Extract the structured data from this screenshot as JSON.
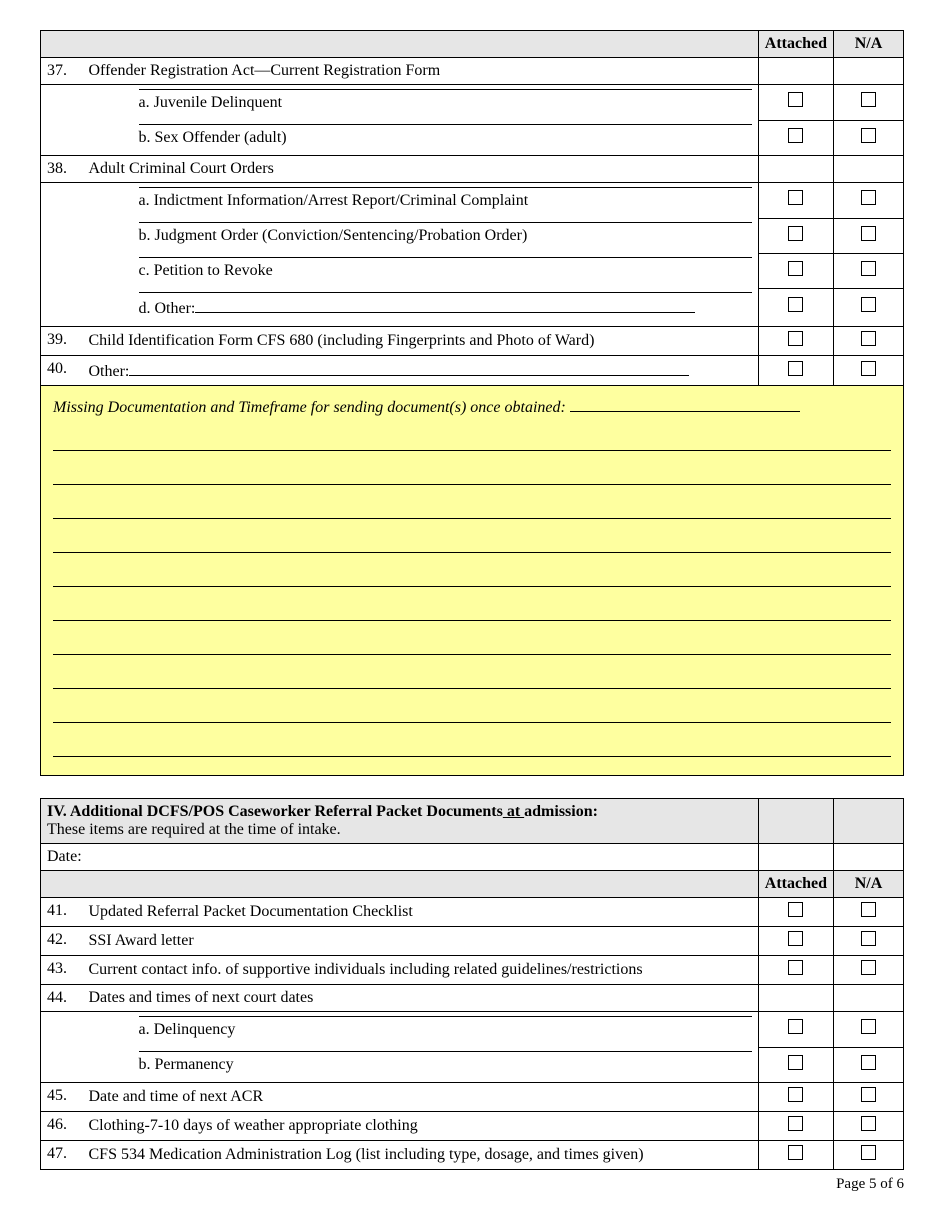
{
  "headers": {
    "attached": "Attached",
    "na": "N/A"
  },
  "rows1": [
    {
      "num": "37.",
      "text": "Offender Registration Act—Current Registration Form",
      "check": false,
      "subs": [
        {
          "text": "a. Juvenile Delinquent"
        },
        {
          "text": "b. Sex Offender (adult)"
        }
      ]
    },
    {
      "num": "38.",
      "text": "Adult Criminal Court Orders",
      "check": false,
      "subs": [
        {
          "text": "a.  Indictment Information/Arrest Report/Criminal Complaint"
        },
        {
          "text": "b. Judgment Order (Conviction/Sentencing/Probation Order)"
        },
        {
          "text": "c. Petition to Revoke"
        },
        {
          "text": "d. Other:",
          "fill": true
        }
      ]
    },
    {
      "num": "39.",
      "text": "Child Identification Form CFS 680  (including Fingerprints and Photo of Ward)",
      "check": true
    },
    {
      "num": "40.",
      "text": "Other:",
      "check": true,
      "fill": true
    }
  ],
  "missing_label": "Missing Documentation and Timeframe for sending document(s) once obtained: ",
  "section4": {
    "title_prefix": "IV. Additional DCFS/POS Caseworker Referral Packet Documents",
    "title_at": " at ",
    "title_suffix": "admission:",
    "subtitle": "These items are required at the time of intake.",
    "date_label": "Date:"
  },
  "rows2": [
    {
      "num": "41.",
      "text": "Updated Referral Packet Documentation Checklist",
      "check": true
    },
    {
      "num": "42.",
      "text": "SSI Award letter",
      "check": true
    },
    {
      "num": "43.",
      "text": "Current contact info. of supportive individuals including related guidelines/restrictions",
      "check": true
    },
    {
      "num": "44.",
      "text": "Dates and times of next court dates",
      "check": false,
      "subs": [
        {
          "text": "a.  Delinquency"
        },
        {
          "text": "b.  Permanency"
        }
      ]
    },
    {
      "num": "45.",
      "text": "Date and time of next ACR",
      "check": true
    },
    {
      "num": "46.",
      "text": "Clothing-7-10 days of weather appropriate clothing",
      "check": true
    },
    {
      "num": "47.",
      "text": "CFS 534 Medication Administration Log (list including type, dosage, and times given)",
      "check": true
    }
  ],
  "page": "Page 5 of 6"
}
